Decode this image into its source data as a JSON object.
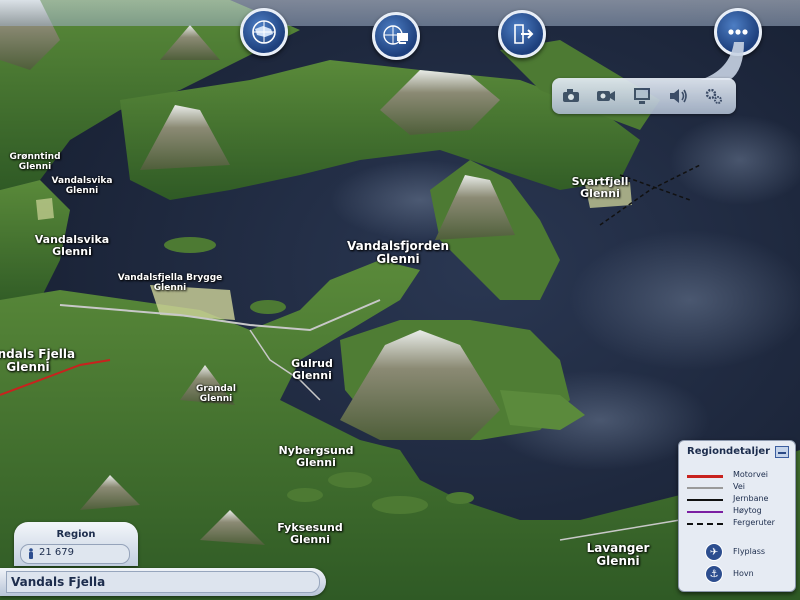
{
  "toolbar": {
    "buttons": [
      {
        "name": "region-view-button",
        "icon": "region-map-icon"
      },
      {
        "name": "city-view-button",
        "icon": "computer-globe-icon"
      },
      {
        "name": "exit-button",
        "icon": "exit-door-icon"
      },
      {
        "name": "more-options-button",
        "icon": "ellipsis-icon"
      }
    ],
    "tools": [
      {
        "name": "camera-tool",
        "icon": "camera-icon"
      },
      {
        "name": "video-tool",
        "icon": "video-camera-icon"
      },
      {
        "name": "display-tool",
        "icon": "monitor-icon"
      },
      {
        "name": "sound-tool",
        "icon": "speaker-icon"
      },
      {
        "name": "settings-tool",
        "icon": "gears-icon"
      }
    ]
  },
  "cities": [
    {
      "id": "gronntind",
      "line1": "Grønntind",
      "line2": "Glenni"
    },
    {
      "id": "vandalsvika-small",
      "line1": "Vandalsvika",
      "line2": "Glenni"
    },
    {
      "id": "vandalsvika",
      "line1": "Vandalsvika",
      "line2": "Glenni"
    },
    {
      "id": "vandalsfjella-brygge",
      "line1": "Vandalsfjella Brygge",
      "line2": "Glenni"
    },
    {
      "id": "vandalsfjorden",
      "line1": "Vandalsfjorden",
      "line2": "Glenni"
    },
    {
      "id": "svartfjell",
      "line1": "Svartfjell",
      "line2": "Glenni"
    },
    {
      "id": "vandals-fjella",
      "line1": "Vandals Fjella",
      "line2": "Glenni"
    },
    {
      "id": "gulrud",
      "line1": "Gulrud",
      "line2": "Glenni"
    },
    {
      "id": "grandal",
      "line1": "Grandal",
      "line2": "Glenni"
    },
    {
      "id": "nybergsund",
      "line1": "Nybergsund",
      "line2": "Glenni"
    },
    {
      "id": "fyksesund",
      "line1": "Fyksesund",
      "line2": "Glenni"
    },
    {
      "id": "lavanger",
      "line1": "Lavanger",
      "line2": "Glenni"
    }
  ],
  "legend": {
    "title": "Regiondetaljer",
    "items": [
      {
        "label": "Motorvei",
        "color": "#c8221e",
        "style": "solid"
      },
      {
        "label": "Vei",
        "color": "#9a9a9a",
        "style": "solid"
      },
      {
        "label": "Jernbane",
        "color": "#111111",
        "style": "solid"
      },
      {
        "label": "Høytog",
        "color": "#7b1fa2",
        "style": "solid"
      },
      {
        "label": "Fergeruter",
        "color": "#111111",
        "style": "dashed"
      }
    ],
    "icons": [
      {
        "label": "Flyplass",
        "icon": "airplane-icon"
      },
      {
        "label": "Hovn",
        "icon": "anchor-icon"
      }
    ]
  },
  "region": {
    "tab_label": "Region",
    "population": "21 679",
    "name": "Vandals Fjella"
  },
  "colors": {
    "water": "#1f2b42",
    "land": "#3f6b2d",
    "ui_blue": "#2a4f8f"
  }
}
